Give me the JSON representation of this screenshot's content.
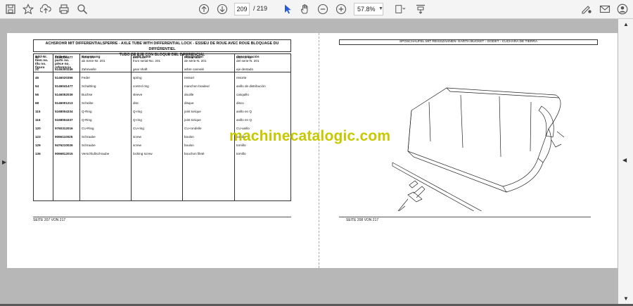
{
  "toolbar": {
    "current_page": "209",
    "total_pages": "/ 219",
    "zoom": "57.8%"
  },
  "left_page": {
    "title_line1": "ACHSROHR MIT DIFFERENTIALSPERRE - AXLE TUBE WITH DIFFERENTIAL LOCK - ESSIEU DE ROUE AVEC ROUE BLOQUAGE DU DIFFÉRENTIEL",
    "title_line2": "TUBO DE EJE CON BLOQUE DEL DIFERENCIAL",
    "headers": {
      "c1": "Bild-Nr.\nItem no.\nIllu no.\nfigura",
      "c2": "Teile-Nr.\nparts no.\npièce no.\nreferencia",
      "c3": "Benennung",
      "c4": "parts name",
      "c5": "designation",
      "c6": "denominación"
    },
    "rows": [
      {
        "item": "12",
        "part": "5146210377",
        "de": "Achsrohr\nab Serie-Nr. 201",
        "en": "axle tube\nfrom serial-No. 201",
        "fr": "essieu tube\nde série-N. 201",
        "es": "tubo de eje\ndel serie-N. 201"
      },
      {
        "item": "21",
        "part": "5146300249",
        "de": "Zahnwelle",
        "en": "gear shaft",
        "fr": "arbre cannelé",
        "es": "eje dentado"
      },
      {
        "item": "46",
        "part": "5146020356",
        "de": "Feder",
        "en": "spring",
        "fr": "ressort",
        "es": "resorte"
      },
      {
        "item": "54",
        "part": "5146041477",
        "de": "Schaltring",
        "en": "control ring",
        "fr": "manchon bradeur",
        "es": "anillo de distribución"
      },
      {
        "item": "56",
        "part": "5146052039",
        "de": "Buchse",
        "en": "sleeve",
        "fr": "douille",
        "es": "casquillo"
      },
      {
        "item": "68",
        "part": "5146001213",
        "de": "Scheibe",
        "en": "disc",
        "fr": "disque",
        "es": "disco"
      },
      {
        "item": "115",
        "part": "5168004334",
        "de": "Q-Ring",
        "en": "Q-ring",
        "fr": "joint torique",
        "es": "anillo en Q"
      },
      {
        "item": "116",
        "part": "5168004337",
        "de": "Q-Ring",
        "en": "Q-ring",
        "fr": "joint torique",
        "es": "anillo en Q"
      },
      {
        "item": "120",
        "part": "9760312016",
        "de": "CU-Ring",
        "en": "CU-ring",
        "fr": "CU-rondelle",
        "es": "CU-anillo"
      },
      {
        "item": "123",
        "part": "9066110025",
        "de": "Schraube",
        "en": "screw",
        "fr": "boulon",
        "es": "tornillo"
      },
      {
        "item": "129",
        "part": "9476210026",
        "de": "Schraube",
        "en": "screw",
        "fr": "boulon",
        "es": "tornillo"
      },
      {
        "item": "136",
        "part": "9066812015",
        "de": "Verschlußschraube",
        "en": "locking screw",
        "fr": "bouchon fileté",
        "es": "tornillo"
      }
    ],
    "footer": "SEITE 207 VON 217"
  },
  "right_page": {
    "title": "SPOSCHAUFEL MIT REISSZÄHNEN- EARTH BUCKET - GODET - CUCHARA DE TIERRA",
    "footer": "SEITE 208 VON 217"
  },
  "watermark": "machinecatalogic.com",
  "icons": [
    "save-icon",
    "bookmark-star-icon",
    "upload-icon",
    "print-icon",
    "zoom-search-icon",
    "page-up-icon",
    "page-down-icon",
    "select-cursor-icon",
    "hand-pan-icon",
    "zoom-out-icon",
    "zoom-in-icon",
    "fit-page-icon",
    "scroll-mode-icon",
    "sign-icon",
    "email-icon",
    "account-icon"
  ]
}
